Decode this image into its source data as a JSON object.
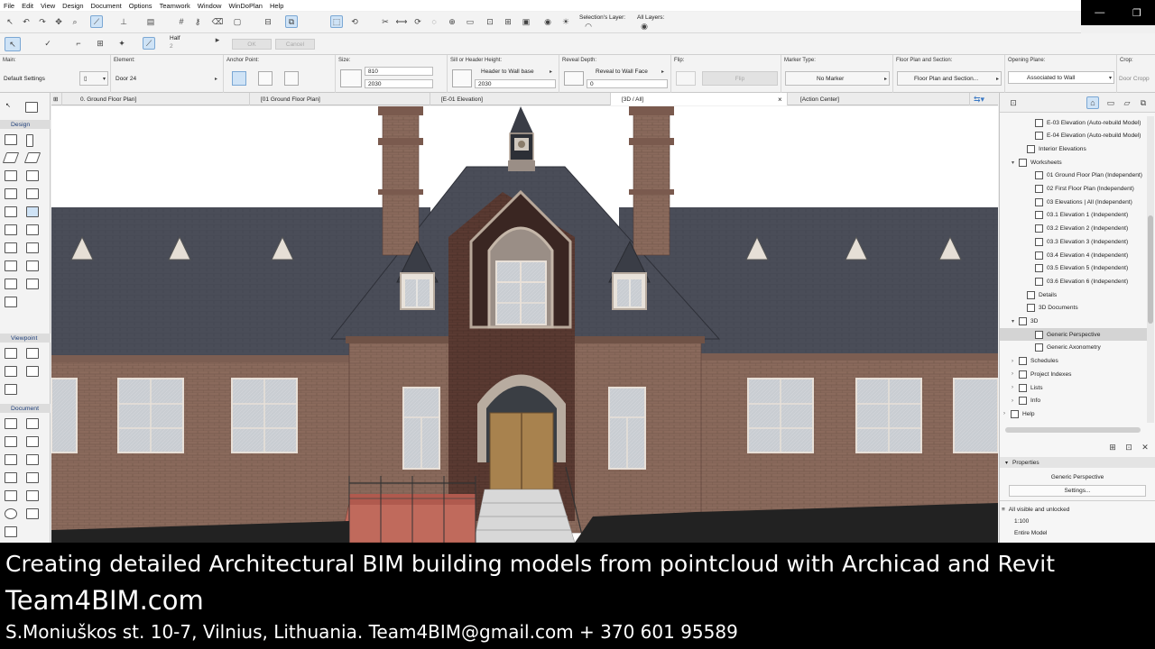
{
  "menu": [
    "File",
    "Edit",
    "View",
    "Design",
    "Document",
    "Options",
    "Teamwork",
    "Window",
    "WinDoPlan",
    "Help"
  ],
  "toolbar1": {
    "selections_layer_label": "Selection's Layer:",
    "all_layers_label": "All Layers:"
  },
  "toolbar2": {
    "half_label": "Half",
    "half_sub": "2",
    "ok_label": "OK",
    "cancel_label": "Cancel"
  },
  "infobox": {
    "main_label": "Main:",
    "default_settings": "Default Settings",
    "element_label": "Element:",
    "element_value": "Door 24",
    "anchor_label": "Anchor Point:",
    "size_label": "Size:",
    "size_width": "810",
    "size_height": "2030",
    "sill_label": "Sill or Header Height:",
    "sill_mode": "Header to Wall base",
    "sill_value": "2030",
    "reveal_label": "Reveal Depth:",
    "reveal_mode": "Reveal to Wall Face",
    "reveal_value": "0",
    "flip_label": "Flip:",
    "flip_button": "Flip",
    "marker_label": "Marker Type:",
    "marker_value": "No Marker",
    "floorplan_label": "Floor Plan and Section:",
    "floorplan_value": "Floor Plan and Section...",
    "opening_label": "Opening Plane:",
    "opening_value": "Associated to Wall",
    "crop_label": "Crop:",
    "crop_value": "Door Cropp"
  },
  "tabs": [
    {
      "label": "0. Ground Floor Plan]"
    },
    {
      "label": "[01 Ground Floor Plan]"
    },
    {
      "label": "[E-01 Elevation]"
    },
    {
      "label": "[3D / All]"
    },
    {
      "label": "[Action Center]"
    }
  ],
  "toolbox": {
    "design": "Design",
    "viewpoint": "Viewpoint",
    "document": "Document"
  },
  "navigator": {
    "items": [
      {
        "label": "E-03 Elevation (Auto-rebuild Model)",
        "indent": 3,
        "tw": ""
      },
      {
        "label": "E-04 Elevation (Auto-rebuild Model)",
        "indent": 3,
        "tw": ""
      },
      {
        "label": "Interior Elevations",
        "indent": 2,
        "tw": ""
      },
      {
        "label": "Worksheets",
        "indent": 1,
        "tw": "v"
      },
      {
        "label": "01 Ground Floor Plan (Independent)",
        "indent": 3,
        "tw": ""
      },
      {
        "label": "02 First Floor Plan (Independent)",
        "indent": 3,
        "tw": ""
      },
      {
        "label": "03 Elevations | All (Independent)",
        "indent": 3,
        "tw": ""
      },
      {
        "label": "03.1 Elevation 1 (Independent)",
        "indent": 3,
        "tw": ""
      },
      {
        "label": "03.2 Elevation 2 (Independent)",
        "indent": 3,
        "tw": ""
      },
      {
        "label": "03.3 Elevation 3 (Independent)",
        "indent": 3,
        "tw": ""
      },
      {
        "label": "03.4 Elevation 4 (Independent)",
        "indent": 3,
        "tw": ""
      },
      {
        "label": "03.5 Elevation 5 (Independent)",
        "indent": 3,
        "tw": ""
      },
      {
        "label": "03.6 Elevation 6 (Independent)",
        "indent": 3,
        "tw": ""
      },
      {
        "label": "Details",
        "indent": 2,
        "tw": ""
      },
      {
        "label": "3D Documents",
        "indent": 2,
        "tw": ""
      },
      {
        "label": "3D",
        "indent": 1,
        "tw": "v"
      },
      {
        "label": "Generic Perspective",
        "indent": 3,
        "tw": "",
        "selected": true
      },
      {
        "label": "Generic Axonometry",
        "indent": 3,
        "tw": ""
      },
      {
        "label": "Schedules",
        "indent": 1,
        "tw": ">"
      },
      {
        "label": "Project Indexes",
        "indent": 1,
        "tw": ">"
      },
      {
        "label": "Lists",
        "indent": 1,
        "tw": ">"
      },
      {
        "label": "Info",
        "indent": 1,
        "tw": ">"
      },
      {
        "label": "Help",
        "indent": 0,
        "tw": ">"
      }
    ]
  },
  "properties": {
    "header": "Properties",
    "name": "Generic Perspective",
    "settings_button": "Settings...",
    "layers": "All visible and unlocked",
    "scale": "1:100",
    "model": "Entire Model"
  },
  "caption": {
    "line1": "Creating detailed Architectural BIM building models from pointcloud with Archicad and Revit",
    "line2": "Team4BIM.com",
    "line3": "S.Moniuškos st. 10-7, Vilnius, Lithuania. Team4BIM@gmail.com + 370 601 95589"
  }
}
